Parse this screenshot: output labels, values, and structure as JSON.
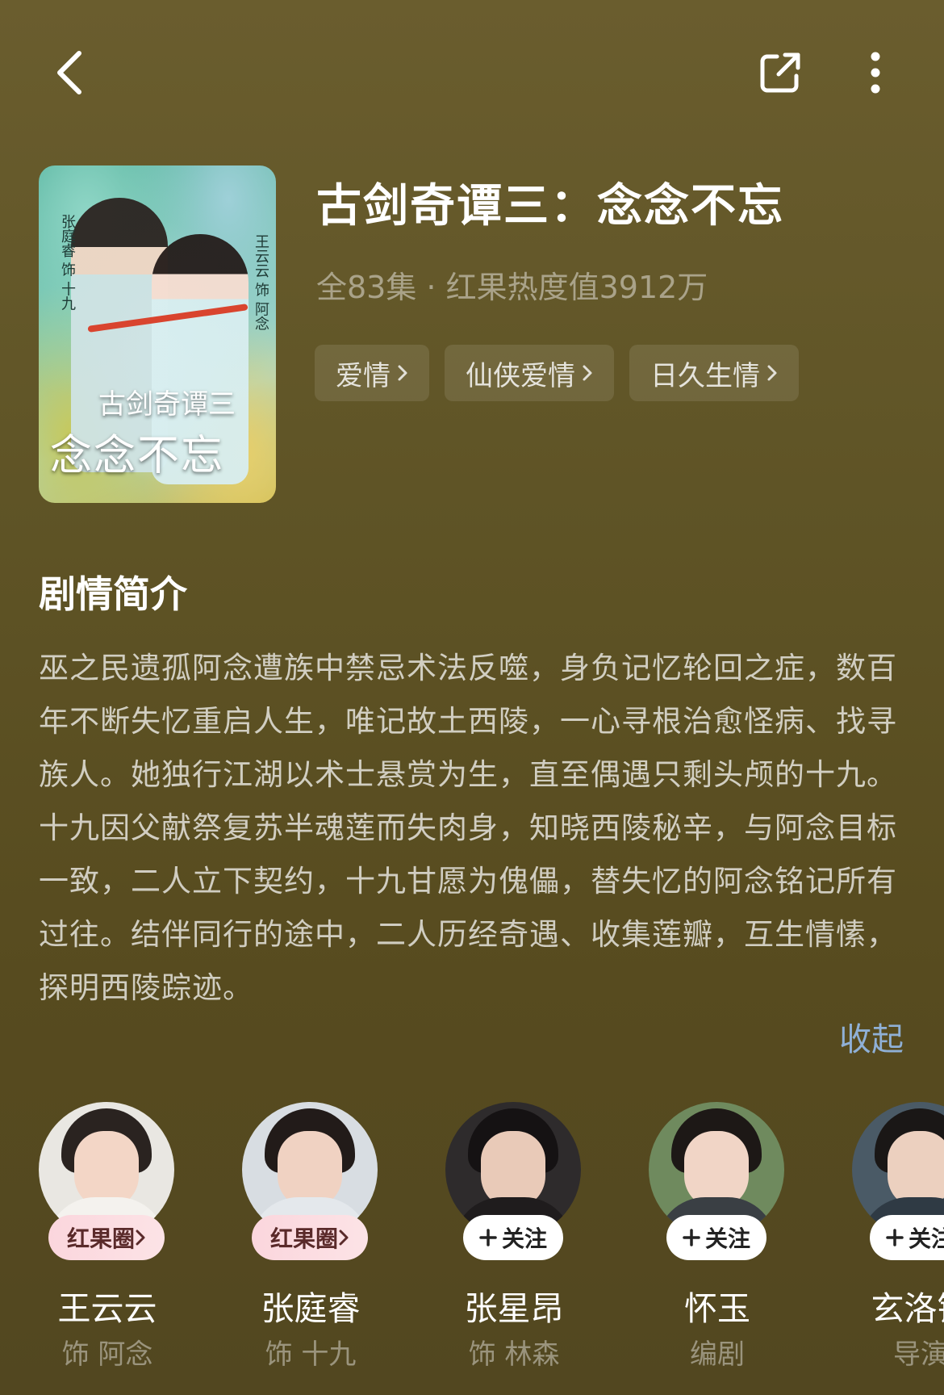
{
  "show": {
    "title": "古剑奇谭三：念念不忘",
    "meta": "全83集 · 红果热度值3912万",
    "tags": [
      "爱情",
      "仙侠爱情",
      "日久生情"
    ],
    "poster": {
      "title_line1": "古剑奇谭三",
      "title_line2": "念念不忘",
      "actor_left": "张庭睿 饰 十九",
      "actor_right": "王云云 饰 阿念"
    }
  },
  "synopsis": {
    "heading": "剧情简介",
    "text": "巫之民遗孤阿念遭族中禁忌术法反噬，身负记忆轮回之症，数百年不断失忆重启人生，唯记故土西陵，一心寻根治愈怪病、找寻族人。她独行江湖以术士悬赏为生，直至偶遇只剩头颅的十九。十九因父献祭复苏半魂莲而失肉身，知晓西陵秘辛，与阿念目标一致，二人立下契约，十九甘愿为傀儡，替失忆的阿念铭记所有过往。结伴同行的途中，二人历经奇遇、收集莲瓣，互生情愫，探明西陵踪迹。",
    "collapse_label": "收起"
  },
  "cast": [
    {
      "name": "王云云",
      "role": "饰 阿念",
      "badge": "红果圈",
      "badge_style": "pink"
    },
    {
      "name": "张庭睿",
      "role": "饰 十九",
      "badge": "红果圈",
      "badge_style": "pink"
    },
    {
      "name": "张星昂",
      "role": "饰 林森",
      "badge": "关注",
      "badge_style": "white"
    },
    {
      "name": "怀玉",
      "role": "编剧",
      "badge": "关注",
      "badge_style": "white"
    },
    {
      "name": "玄洛铧",
      "role": "导演",
      "badge": "关注",
      "badge_style": "white"
    }
  ],
  "icons": {
    "back": "back-chevron-icon",
    "share": "share-icon",
    "more": "more-vertical-icon"
  },
  "colors": {
    "background": "#5f5426",
    "link": "#8fb0d6",
    "badge_pink": "#fbd6dd"
  }
}
